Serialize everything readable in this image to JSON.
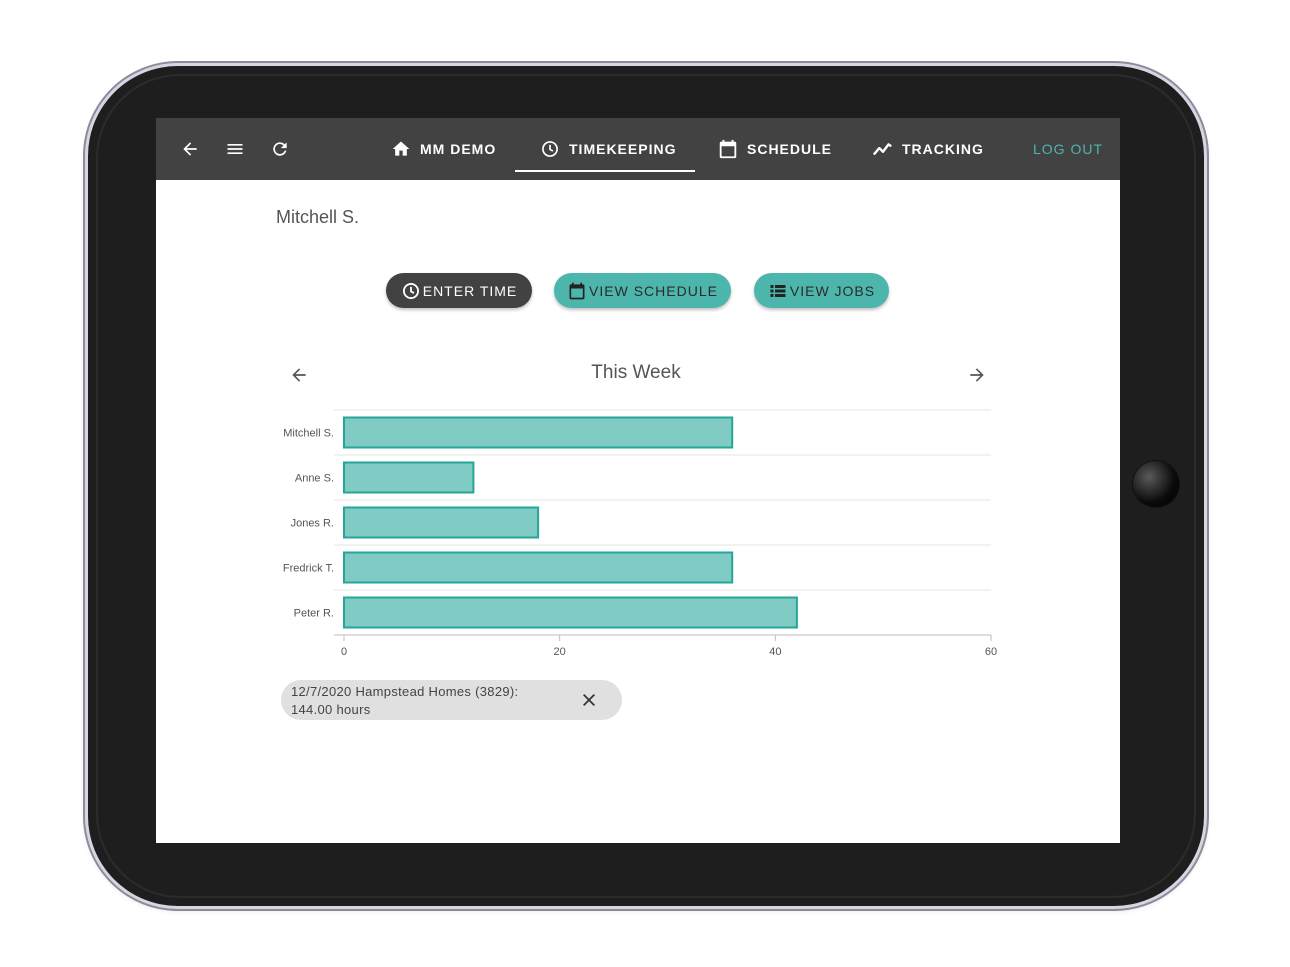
{
  "appbar": {
    "nav": [
      {
        "label": "MM DEMO",
        "icon": "home-icon"
      },
      {
        "label": "TIMEKEEPING",
        "icon": "clock-icon",
        "active": true
      },
      {
        "label": "SCHEDULE",
        "icon": "calendar-icon"
      },
      {
        "label": "TRACKING",
        "icon": "trending-icon"
      }
    ],
    "logout_label": "LOG OUT"
  },
  "user_name": "Mitchell S.",
  "actions": {
    "enter_time": "ENTER TIME",
    "view_schedule": "VIEW SCHEDULE",
    "view_jobs": "VIEW JOBS"
  },
  "week_title": "This Week",
  "chart_data": {
    "type": "bar",
    "orientation": "horizontal",
    "categories": [
      "Mitchell S.",
      "Anne S.",
      "Jones R.",
      "Fredrick T.",
      "Peter R."
    ],
    "values": [
      36,
      12,
      18,
      36,
      42
    ],
    "xlim": [
      0,
      60
    ],
    "xticks": [
      0,
      20,
      40,
      60
    ],
    "grid": true,
    "bar_fill": "#80cbc4",
    "bar_stroke": "#26a69a"
  },
  "chip": {
    "line1": "12/7/2020 Hampstead Homes (3829):",
    "line2": "144.00 hours"
  },
  "colors": {
    "appbar": "#424242",
    "accent": "#4db6ac"
  }
}
